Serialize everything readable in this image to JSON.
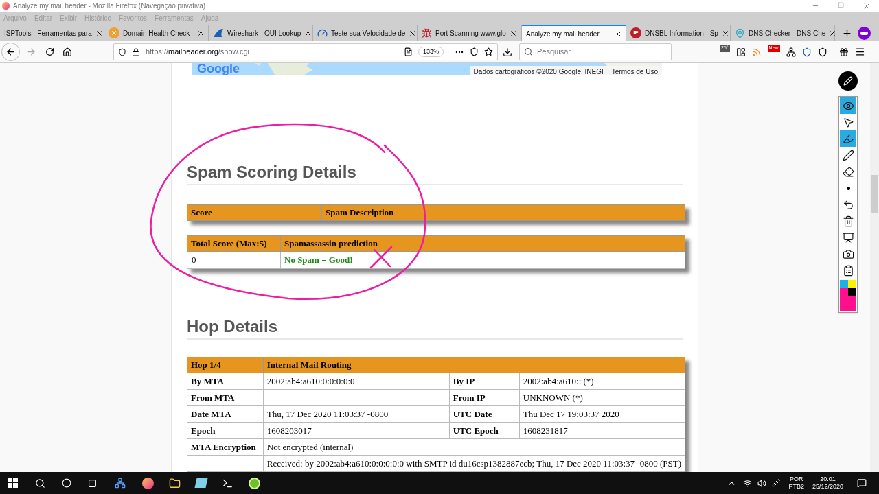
{
  "window": {
    "title": "Analyze my mail header - Mozilla Firefox (Navegação privativa)"
  },
  "menu": [
    "Arquivo",
    "Editar",
    "Exibir",
    "Histórico",
    "Favoritos",
    "Ferramentas",
    "Ajuda"
  ],
  "tabs": [
    {
      "label": "ISPTools - Ferramentas para",
      "selected": false
    },
    {
      "label": "Domain Health Check -",
      "selected": false
    },
    {
      "label": "Wireshark - OUI Lookup",
      "selected": false
    },
    {
      "label": "Teste sua Velocidade de",
      "selected": false
    },
    {
      "label": "Port Scanning www.glo",
      "selected": false
    },
    {
      "label": "Analyze my mail header",
      "selected": true
    },
    {
      "label": "DNSBL Information - Sp",
      "selected": false
    },
    {
      "label": "DNS Checker - DNS Che",
      "selected": false
    }
  ],
  "tab_ip_badge": "IP",
  "address": {
    "scheme": "https://",
    "domain": "mailheader.org",
    "path": "/show.cgi",
    "zoom": "133%"
  },
  "search": {
    "placeholder": "Pesquisar"
  },
  "toolbar_badges": {
    "weather": "25°",
    "news": "New"
  },
  "map": {
    "logo": "Google",
    "attribution": "Dados cartográficos ©2020 Google, INEGI",
    "terms": "Termos de Uso"
  },
  "spam": {
    "heading": "Spam Scoring Details",
    "table1": {
      "columns": [
        "Score",
        "Spam Description"
      ]
    },
    "table2": {
      "columns": [
        "Total Score (Max:5)",
        "Spamassassin prediction"
      ],
      "row": [
        "0",
        "No Spam = Good!"
      ]
    }
  },
  "hop": {
    "heading": "Hop Details",
    "header": {
      "hop": "Hop 1/4",
      "title": "Internal Mail Routing"
    },
    "rows": [
      {
        "kind": "pair",
        "cells": [
          "By MTA",
          "2002:ab4:a610:0:0:0:0:0",
          "By IP",
          "2002:ab4:a610:: (*)"
        ]
      },
      {
        "kind": "pair",
        "cells": [
          "From MTA",
          "",
          "From IP",
          "UNKNOWN (*)"
        ]
      },
      {
        "kind": "pair",
        "cells": [
          "Date MTA",
          "Thu, 17 Dec 2020 11:03:37 -0800",
          "UTC Date",
          "Thu Dec 17 19:03:37 2020"
        ]
      },
      {
        "kind": "pair",
        "cells": [
          "Epoch",
          "1608203017",
          "UTC Epoch",
          "1608231817"
        ]
      },
      {
        "kind": "wide",
        "label": "MTA Encryption",
        "value": "Not encrypted (internal)"
      },
      {
        "kind": "wide",
        "value": "Received: by 2002:ab4:a610:0:0:0:0:0 with SMTP id du16csp1382887ecb; Thu, 17 Dec 2020 11:03:37 -0800 (PST)"
      }
    ]
  },
  "pen_tools": [
    {
      "kind": "eye",
      "selected": true
    },
    {
      "kind": "pointer",
      "selected": false
    },
    {
      "kind": "highlighter",
      "selected": true
    },
    {
      "kind": "pen",
      "selected": false
    },
    {
      "kind": "eraser",
      "selected": false
    },
    {
      "kind": "dot",
      "selected": false
    },
    {
      "kind": "undo",
      "selected": false
    },
    {
      "kind": "trash",
      "selected": false
    },
    {
      "kind": "board",
      "selected": false
    },
    {
      "kind": "camera",
      "selected": false
    },
    {
      "kind": "clipboard",
      "selected": false
    }
  ],
  "pen_colors": [
    {
      "color": "#1ab0e8"
    },
    {
      "color": "#fff200"
    },
    {
      "color": "#ff0f8c"
    },
    {
      "color": "#000000"
    }
  ],
  "taskbar": {
    "lang": "POR",
    "layout": "PTB2",
    "time": "20:01",
    "date": "25/12/2020"
  }
}
